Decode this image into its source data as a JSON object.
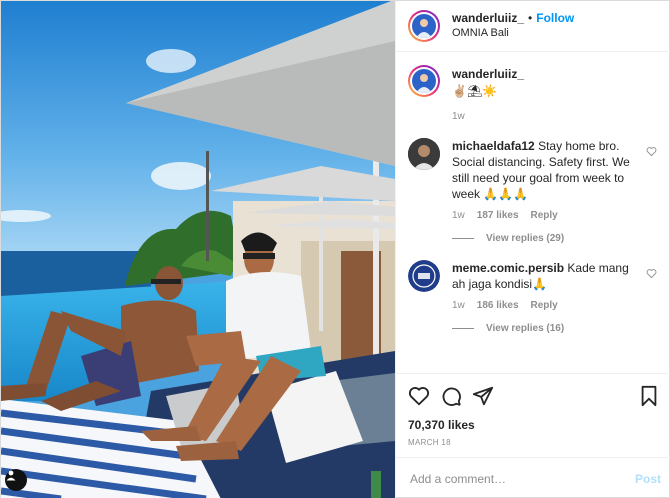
{
  "colors": {
    "accent": "#0095f6",
    "muted": "#8e8e8e",
    "post_disabled": "#b2dffc"
  },
  "post": {
    "photo_alt": "Two men sitting on a poolside daybed under white parasols",
    "tag_icon": "user-tag-icon"
  },
  "header": {
    "username": "wanderluiiz_",
    "separator": "•",
    "follow_label": "Follow",
    "location": "OMNIA Bali"
  },
  "caption": {
    "username": "wanderluiiz_",
    "text": "✌🏼⛱☀️",
    "time": "1w"
  },
  "comments": [
    {
      "username": "michaeldafa12",
      "text": "Stay home bro. Social distancing. Safety first. We still need your goal from week to week 🙏🙏🙏",
      "time": "1w",
      "likes": "187 likes",
      "reply_label": "Reply",
      "view_replies": "View replies (29)"
    },
    {
      "username": "meme.comic.persib",
      "text": "Kade mang ah jaga kondisi🙏",
      "time": "1w",
      "likes": "186 likes",
      "reply_label": "Reply",
      "view_replies": "View replies (16)"
    }
  ],
  "actions": {
    "like_icon": "heart-icon",
    "comment_icon": "comment-icon",
    "share_icon": "share-icon",
    "save_icon": "bookmark-icon",
    "likes": "70,370 likes",
    "date": "MARCH 18"
  },
  "add_comment": {
    "placeholder": "Add a comment…",
    "post_label": "Post"
  }
}
